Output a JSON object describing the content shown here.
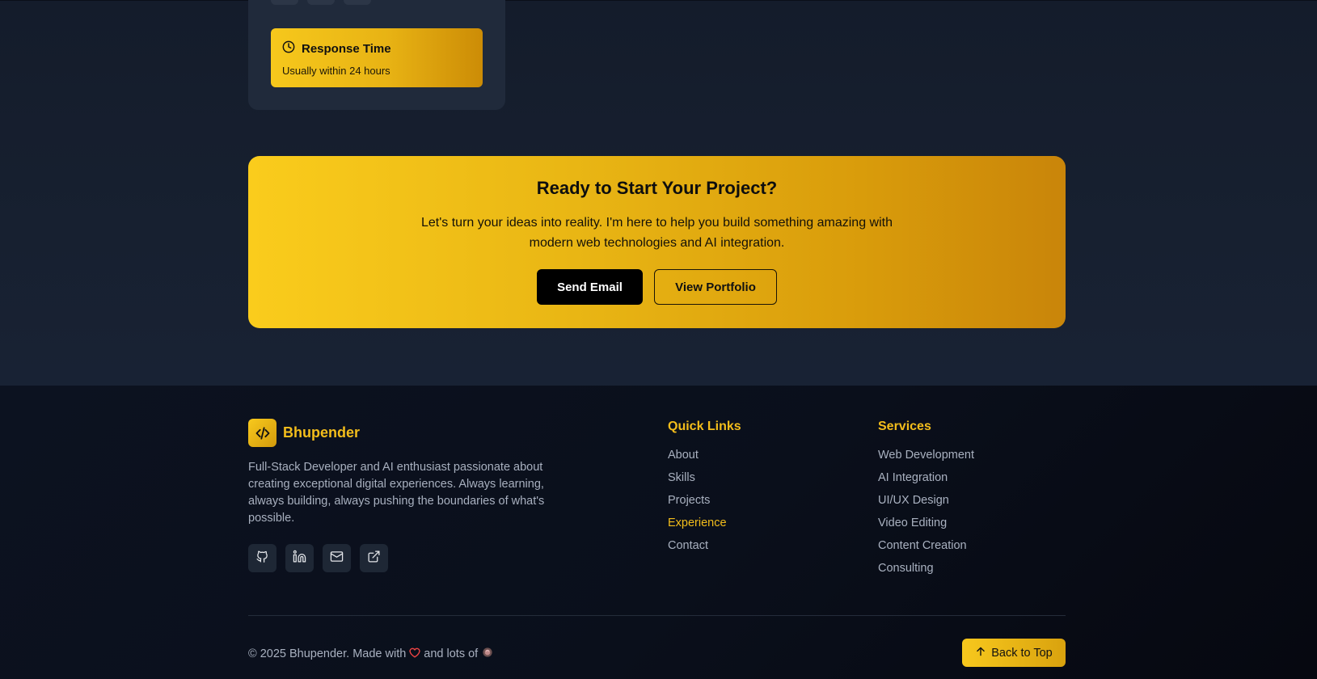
{
  "contact_card": {
    "response_title": "Response Time",
    "response_text": "Usually within 24 hours",
    "icons": [
      "clock-icon"
    ]
  },
  "cta": {
    "title": "Ready to Start Your Project?",
    "text": "Let's turn your ideas into reality. I'm here to help you build something amazing with modern web technologies and AI integration.",
    "primary_label": "Send Email",
    "secondary_label": "View Portfolio"
  },
  "footer": {
    "brand_name": "Bhupender",
    "brand_icon": "code-icon",
    "about": "Full-Stack Developer and AI enthusiast passionate about creating exceptional digital experiences. Always learning, always building, always pushing the boundaries of what's possible.",
    "socials": [
      "github-icon",
      "linkedin-icon",
      "mail-icon",
      "external-link-icon"
    ],
    "quick_links": {
      "title": "Quick Links",
      "items": [
        "About",
        "Skills",
        "Projects",
        "Experience",
        "Contact"
      ],
      "active": "Experience"
    },
    "services": {
      "title": "Services",
      "items": [
        "Web Development",
        "AI Integration",
        "UI/UX Design",
        "Video Editing",
        "Content Creation",
        "Consulting"
      ]
    },
    "copyright_prefix": "© 2025 Bhupender. Made with",
    "copyright_middle": "and lots of",
    "back_to_top": "Back to Top"
  },
  "colors": {
    "accent": "#f3bd1b",
    "accent_dark": "#c9850a",
    "background": "#0b1120",
    "heart": "#ef4444"
  }
}
